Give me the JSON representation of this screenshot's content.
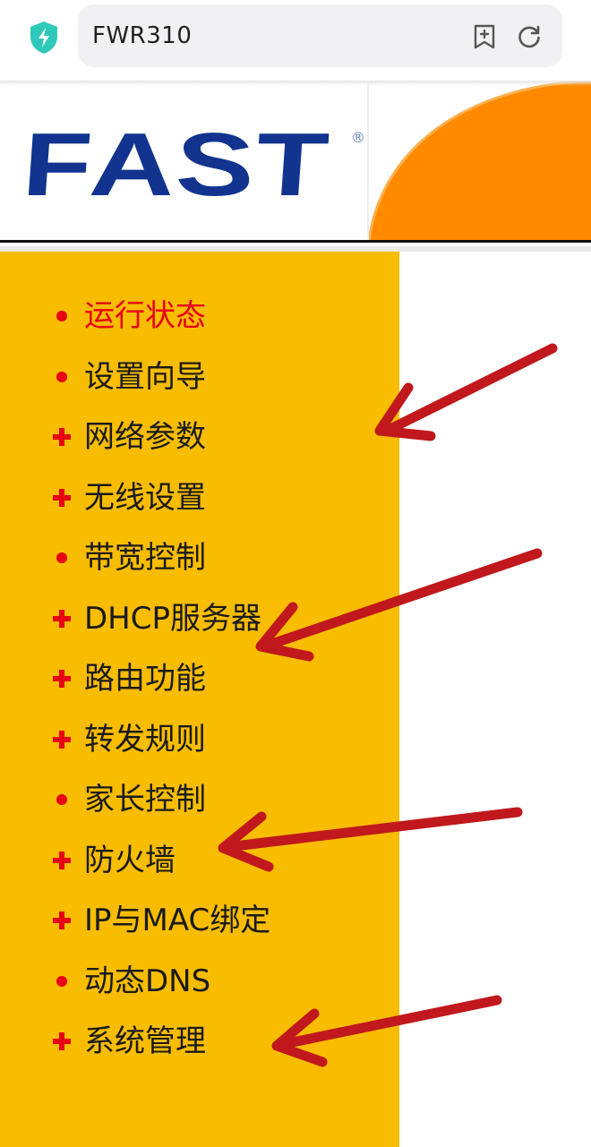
{
  "browser": {
    "url": "FWR310",
    "icons": {
      "security": "shield-bolt-icon",
      "bookmark": "bookmark-add-icon",
      "refresh": "refresh-icon"
    }
  },
  "header": {
    "logo": "FAST",
    "logo_mark": "®",
    "brand_color": "#12348f",
    "accent_color": "#ff8a00"
  },
  "menu": {
    "background": "#f8bc00",
    "items": [
      {
        "label": "运行状态",
        "bullet": "dot",
        "active": true
      },
      {
        "label": "设置向导",
        "bullet": "dot",
        "active": false
      },
      {
        "label": "网络参数",
        "bullet": "plus",
        "active": false
      },
      {
        "label": "无线设置",
        "bullet": "plus",
        "active": false
      },
      {
        "label": "带宽控制",
        "bullet": "dot",
        "active": false
      },
      {
        "label": "DHCP服务器",
        "bullet": "plus",
        "active": false
      },
      {
        "label": "路由功能",
        "bullet": "plus",
        "active": false
      },
      {
        "label": "转发规则",
        "bullet": "plus",
        "active": false
      },
      {
        "label": "家长控制",
        "bullet": "dot",
        "active": false
      },
      {
        "label": "防火墙",
        "bullet": "plus",
        "active": false
      },
      {
        "label": "IP与MAC绑定",
        "bullet": "plus",
        "active": false
      },
      {
        "label": "动态DNS",
        "bullet": "dot",
        "active": false
      },
      {
        "label": "系统管理",
        "bullet": "plus",
        "active": false
      }
    ]
  },
  "annotations": {
    "arrow_color": "#c0181c",
    "arrows_point_to": [
      "网络参数",
      "DHCP服务器",
      "防火墙",
      "系统管理"
    ]
  }
}
